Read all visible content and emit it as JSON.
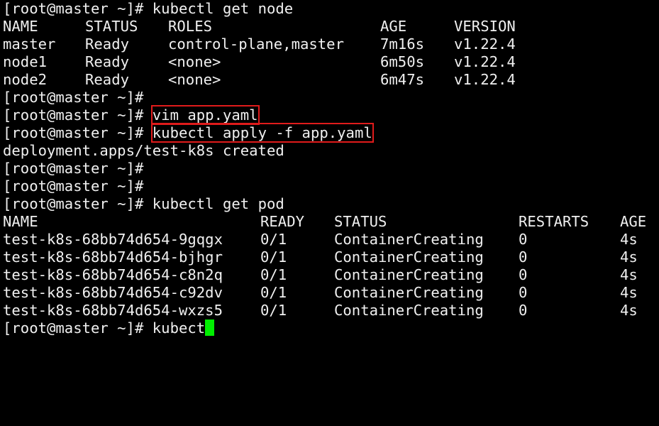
{
  "colors": {
    "background": "#000000",
    "foreground": "#f0f0f0",
    "highlight_box": "#e01b1b",
    "cursor": "#00ee00"
  },
  "prompt": "[root@master ~]# ",
  "cmd1": "kubectl get node",
  "node_headers": [
    "NAME",
    "STATUS",
    "ROLES",
    "AGE",
    "VERSION"
  ],
  "nodes": [
    [
      "master",
      "Ready",
      "control-plane,master",
      "7m16s",
      "v1.22.4"
    ],
    [
      "node1",
      "Ready",
      "<none>",
      "6m50s",
      "v1.22.4"
    ],
    [
      "node2",
      "Ready",
      "<none>",
      "6m47s",
      "v1.22.4"
    ]
  ],
  "cmd_vim": "vim app.yaml",
  "cmd_apply": "kubectl apply -f app.yaml",
  "apply_output": "deployment.apps/test-k8s created",
  "cmd_getpod": "kubectl get pod",
  "pod_headers": [
    "NAME",
    "READY",
    "STATUS",
    "RESTARTS",
    "AGE"
  ],
  "pods": [
    [
      "test-k8s-68bb74d654-9gqgx",
      "0/1",
      "ContainerCreating",
      "0",
      "4s"
    ],
    [
      "test-k8s-68bb74d654-bjhgr",
      "0/1",
      "ContainerCreating",
      "0",
      "4s"
    ],
    [
      "test-k8s-68bb74d654-c8n2q",
      "0/1",
      "ContainerCreating",
      "0",
      "4s"
    ],
    [
      "test-k8s-68bb74d654-c92dv",
      "0/1",
      "ContainerCreating",
      "0",
      "4s"
    ],
    [
      "test-k8s-68bb74d654-wxzs5",
      "0/1",
      "ContainerCreating",
      "0",
      "4s"
    ]
  ],
  "current_input": "kubect"
}
